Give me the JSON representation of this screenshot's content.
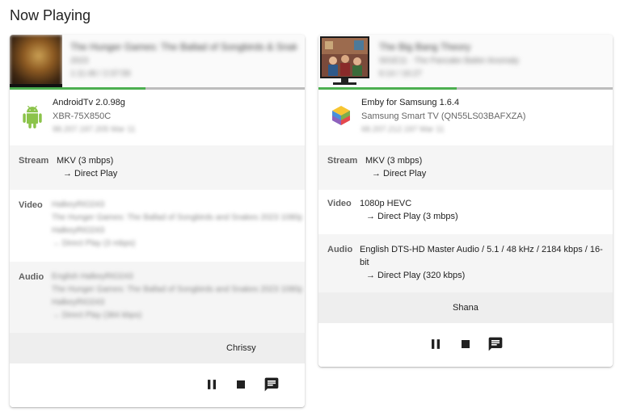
{
  "page": {
    "title": "Now Playing"
  },
  "sessions": [
    {
      "media": {
        "title": "The Hunger Games: The Ballad of Songbirds & Snakes",
        "subtitle": "2023",
        "time": "1:11:46 / 2:37:59"
      },
      "progress": 0.46,
      "client": {
        "name": "AndroidTv 2.0.98g",
        "device": "XBR-75X850C",
        "ip": "98.207.197.205 Mar 11"
      },
      "stream": {
        "label": "Stream",
        "value": "MKV (3 mbps)",
        "method": "→  Direct Play"
      },
      "video": {
        "label": "Video",
        "line1": "HalkeyRIO243",
        "line2": "The Hunger Games: The Ballad of Songbirds and Snakes 2023 1080p",
        "line3": "HalkeyRIO243",
        "line4": "→  Direct Play (3 mbps)"
      },
      "audio": {
        "label": "Audio",
        "line1": "English HalkeyRIO243",
        "line2": "The Hunger Games: The Ballad of Songbirds and Snakes 2023 1080p",
        "line3": "HalkeyRIO243",
        "line4": "→  Direct Play (384 kbps)"
      },
      "user": "Chrissy",
      "controls": {
        "pause": "pause-icon",
        "stop": "stop-icon",
        "message": "message-icon"
      }
    },
    {
      "media": {
        "title": "The Big Bang Theory",
        "subtitle": "S01E11 · The Pancake Batter Anomaly",
        "time": "6:14 / 16:27"
      },
      "progress": 0.47,
      "client": {
        "name": "Emby for Samsung 1.6.4",
        "device": "Samsung Smart TV (QN55LS03BAFXZA)",
        "ip": "68.207.212.197 Mar 11"
      },
      "stream": {
        "label": "Stream",
        "value": "MKV (3 mbps)",
        "method": "→  Direct Play"
      },
      "video": {
        "label": "Video",
        "value": "1080p HEVC",
        "method": "→  Direct Play (3 mbps)"
      },
      "audio": {
        "label": "Audio",
        "value_line1": "English DTS-HD Master Audio / 5.1 / 48 kHz / 2184 kbps / 16-",
        "value_line2": "bit",
        "method": "→  Direct Play (320 kbps)"
      },
      "user": "Shana",
      "controls": {
        "pause": "pause-icon",
        "stop": "stop-icon",
        "message": "message-icon"
      }
    }
  ],
  "colors": {
    "progress_fill": "#4caf50",
    "android_green": "#8bc34a"
  }
}
